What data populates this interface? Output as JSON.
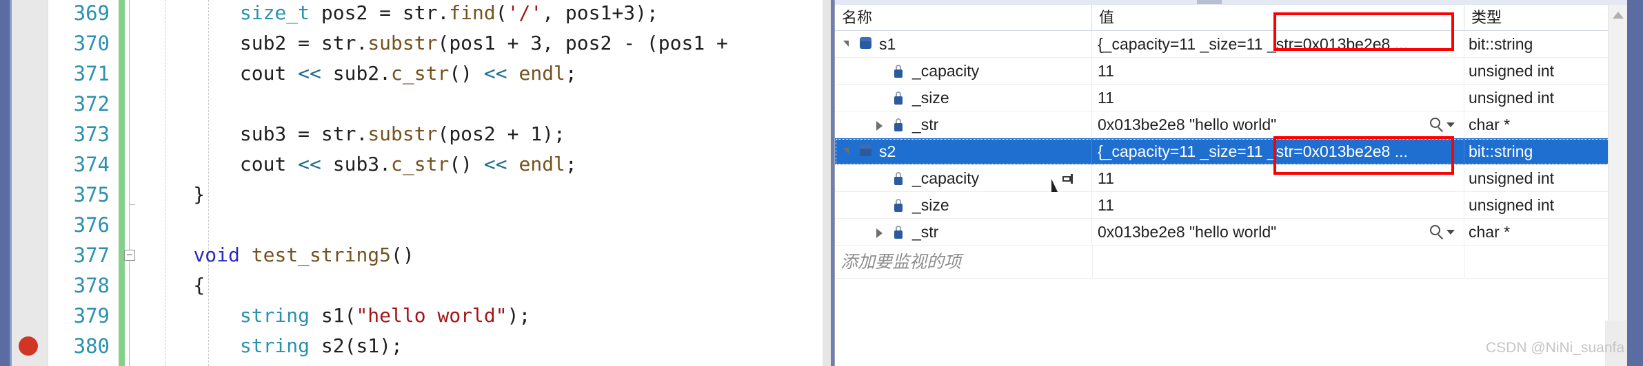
{
  "editor": {
    "gutter": {
      "breakpoint_line": "380"
    },
    "lines": [
      {
        "number": "369",
        "tokens": [
          {
            "t": "        ",
            "c": "plain"
          },
          {
            "t": "size_t",
            "c": "type"
          },
          {
            "t": " pos2 ",
            "c": "plain"
          },
          {
            "t": "=",
            "c": "plain"
          },
          {
            "t": " str",
            "c": "plain"
          },
          {
            "t": ".",
            "c": "plain"
          },
          {
            "t": "find",
            "c": "func"
          },
          {
            "t": "(",
            "c": "plain"
          },
          {
            "t": "'/'",
            "c": "str"
          },
          {
            "t": ", pos1+3);",
            "c": "plain"
          }
        ]
      },
      {
        "number": "370",
        "tokens": [
          {
            "t": "        sub2 ",
            "c": "plain"
          },
          {
            "t": "=",
            "c": "plain"
          },
          {
            "t": " str",
            "c": "plain"
          },
          {
            "t": ".",
            "c": "plain"
          },
          {
            "t": "substr",
            "c": "func"
          },
          {
            "t": "(pos1 + 3, pos2 - (pos1 +",
            "c": "plain"
          }
        ]
      },
      {
        "number": "371",
        "tokens": [
          {
            "t": "        cout ",
            "c": "plain"
          },
          {
            "t": "<<",
            "c": "op"
          },
          {
            "t": " sub2",
            "c": "plain"
          },
          {
            "t": ".",
            "c": "plain"
          },
          {
            "t": "c_str",
            "c": "func"
          },
          {
            "t": "() ",
            "c": "plain"
          },
          {
            "t": "<<",
            "c": "op"
          },
          {
            "t": " ",
            "c": "plain"
          },
          {
            "t": "endl",
            "c": "func"
          },
          {
            "t": ";",
            "c": "plain"
          }
        ]
      },
      {
        "number": "372",
        "tokens": []
      },
      {
        "number": "373",
        "tokens": [
          {
            "t": "        sub3 ",
            "c": "plain"
          },
          {
            "t": "=",
            "c": "plain"
          },
          {
            "t": " str",
            "c": "plain"
          },
          {
            "t": ".",
            "c": "plain"
          },
          {
            "t": "substr",
            "c": "func"
          },
          {
            "t": "(pos2 + 1);",
            "c": "plain"
          }
        ]
      },
      {
        "number": "374",
        "tokens": [
          {
            "t": "        cout ",
            "c": "plain"
          },
          {
            "t": "<<",
            "c": "op"
          },
          {
            "t": " sub3",
            "c": "plain"
          },
          {
            "t": ".",
            "c": "plain"
          },
          {
            "t": "c_str",
            "c": "func"
          },
          {
            "t": "() ",
            "c": "plain"
          },
          {
            "t": "<<",
            "c": "op"
          },
          {
            "t": " ",
            "c": "plain"
          },
          {
            "t": "endl",
            "c": "func"
          },
          {
            "t": ";",
            "c": "plain"
          }
        ]
      },
      {
        "number": "375",
        "tokens": [
          {
            "t": "    }",
            "c": "plain"
          }
        ]
      },
      {
        "number": "376",
        "tokens": []
      },
      {
        "number": "377",
        "tokens": [
          {
            "t": "    ",
            "c": "plain"
          },
          {
            "t": "void",
            "c": "kw"
          },
          {
            "t": " ",
            "c": "plain"
          },
          {
            "t": "test_string5",
            "c": "func"
          },
          {
            "t": "()",
            "c": "plain"
          }
        ]
      },
      {
        "number": "378",
        "tokens": [
          {
            "t": "    {",
            "c": "plain"
          }
        ]
      },
      {
        "number": "379",
        "tokens": [
          {
            "t": "        ",
            "c": "plain"
          },
          {
            "t": "string",
            "c": "type"
          },
          {
            "t": " s1(",
            "c": "plain"
          },
          {
            "t": "\"hello world\"",
            "c": "str"
          },
          {
            "t": ");",
            "c": "plain"
          }
        ]
      },
      {
        "number": "380",
        "tokens": [
          {
            "t": "        ",
            "c": "plain"
          },
          {
            "t": "string",
            "c": "type"
          },
          {
            "t": " s2(s1);",
            "c": "plain"
          }
        ]
      }
    ]
  },
  "watch": {
    "headers": {
      "name": "名称",
      "value": "值",
      "type": "类型"
    },
    "rows": [
      {
        "name": "s1",
        "value": "{_capacity=11 _size=11 _str=0x013be2e8 ...",
        "type": "bit::string",
        "indent": 0,
        "expander": "open",
        "icon": "object-icon",
        "selected": false,
        "magnifier": false,
        "pin": false
      },
      {
        "name": "_capacity",
        "value": "11",
        "type": "unsigned int",
        "indent": 1,
        "expander": "none",
        "icon": "field-icon",
        "selected": false,
        "magnifier": false,
        "pin": false
      },
      {
        "name": "_size",
        "value": "11",
        "type": "unsigned int",
        "indent": 1,
        "expander": "none",
        "icon": "field-icon",
        "selected": false,
        "magnifier": false,
        "pin": false
      },
      {
        "name": "_str",
        "value": "0x013be2e8 \"hello world\"",
        "type": "char *",
        "indent": 1,
        "expander": "closed",
        "icon": "field-icon",
        "selected": false,
        "magnifier": true,
        "pin": false
      },
      {
        "name": "s2",
        "value": "{_capacity=11 _size=11 _str=0x013be2e8 ...",
        "type": "bit::string",
        "indent": 0,
        "expander": "open",
        "icon": "object-icon",
        "selected": true,
        "magnifier": false,
        "pin": false
      },
      {
        "name": "_capacity",
        "value": "11",
        "type": "unsigned int",
        "indent": 1,
        "expander": "none",
        "icon": "field-icon",
        "selected": false,
        "magnifier": false,
        "pin": true
      },
      {
        "name": "_size",
        "value": "11",
        "type": "unsigned int",
        "indent": 1,
        "expander": "none",
        "icon": "field-icon",
        "selected": false,
        "magnifier": false,
        "pin": false
      },
      {
        "name": "_str",
        "value": "0x013be2e8 \"hello world\"",
        "type": "char *",
        "indent": 1,
        "expander": "closed",
        "icon": "field-icon",
        "selected": false,
        "magnifier": true,
        "pin": false
      }
    ],
    "add_item_placeholder": "添加要监视的项"
  },
  "annotations": {
    "highlight_color": "#ff0000",
    "boxes": [
      {
        "label": "s1-str-highlight"
      },
      {
        "label": "s2-str-highlight"
      }
    ]
  },
  "watermark": {
    "text": "CSDN @NiNi_suanfa"
  },
  "colors": {
    "selection_blue": "#1f6fd0",
    "change_bar_green": "#84d28a",
    "breakpoint_red": "#cf3724",
    "line_number_blue": "#2b91af",
    "annotation_red": "#ff0000"
  }
}
